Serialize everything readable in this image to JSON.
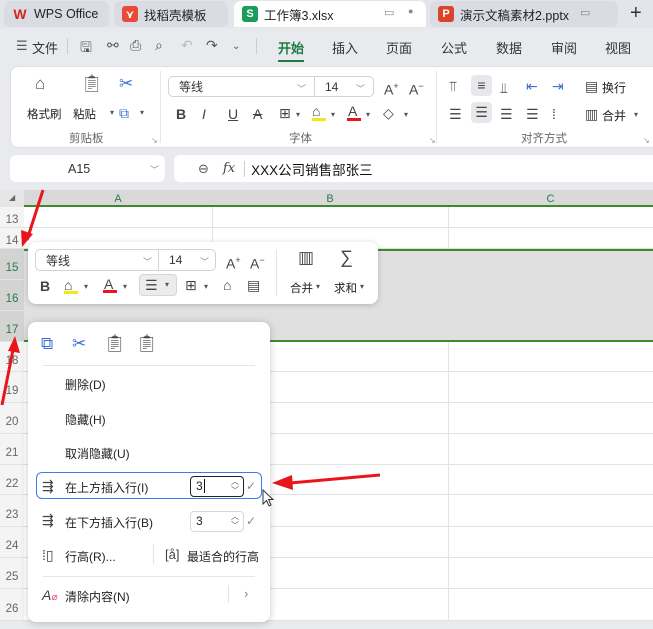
{
  "tabs": [
    {
      "label": "WPS Office",
      "icon": "wps-logo-icon",
      "active": false
    },
    {
      "label": "找稻壳模板",
      "icon": "docer-icon",
      "active": false
    },
    {
      "label": "工作簿3.xlsx",
      "icon": "spreadsheet-icon",
      "icon_letter": "S",
      "active": true
    },
    {
      "label": "演示文稿素材2.pptx",
      "icon": "presentation-icon",
      "icon_letter": "P",
      "active": false
    }
  ],
  "new_tab": "+",
  "menu": {
    "file": "文件",
    "items": [
      "开始",
      "插入",
      "页面",
      "公式",
      "数据",
      "审阅",
      "视图"
    ],
    "active": "开始"
  },
  "ribbon": {
    "clipboard": {
      "format_painter": "格式刷",
      "paste": "粘贴",
      "group": "剪贴板"
    },
    "font": {
      "name": "等线",
      "size": "14",
      "group": "字体",
      "bold": "B",
      "italic": "I",
      "underline": "U",
      "strike": "A"
    },
    "alignment": {
      "wrap": "换行",
      "merge": "合并",
      "group": "对齐方式"
    }
  },
  "formula_bar": {
    "cell_ref": "A15",
    "fx": "fx",
    "content": "XXX公司销售部张三"
  },
  "columns": [
    "A",
    "B",
    "C"
  ],
  "rows": [
    "13",
    "14",
    "15",
    "16",
    "17",
    "18",
    "19",
    "20",
    "21",
    "22",
    "23",
    "24",
    "25",
    "26"
  ],
  "selected_rows": [
    "15",
    "16",
    "17"
  ],
  "mini_toolbar": {
    "font_name": "等线",
    "font_size": "14",
    "bold": "B",
    "merge": "合并",
    "sum": "求和"
  },
  "context_menu": {
    "delete": "删除(D)",
    "hide": "隐藏(H)",
    "unhide": "取消隐藏(U)",
    "insert_above": "在上方插入行(I)",
    "insert_above_count": "3",
    "insert_below": "在下方插入行(B)",
    "insert_below_count": "3",
    "row_height": "行高(R)...",
    "best_fit_height": "最适合的行高",
    "clear_content": "清除内容(N)"
  },
  "colors": {
    "accent_green": "#1e7b45",
    "annotation_red": "#e8161b",
    "focus_blue": "#3b7ce8"
  }
}
